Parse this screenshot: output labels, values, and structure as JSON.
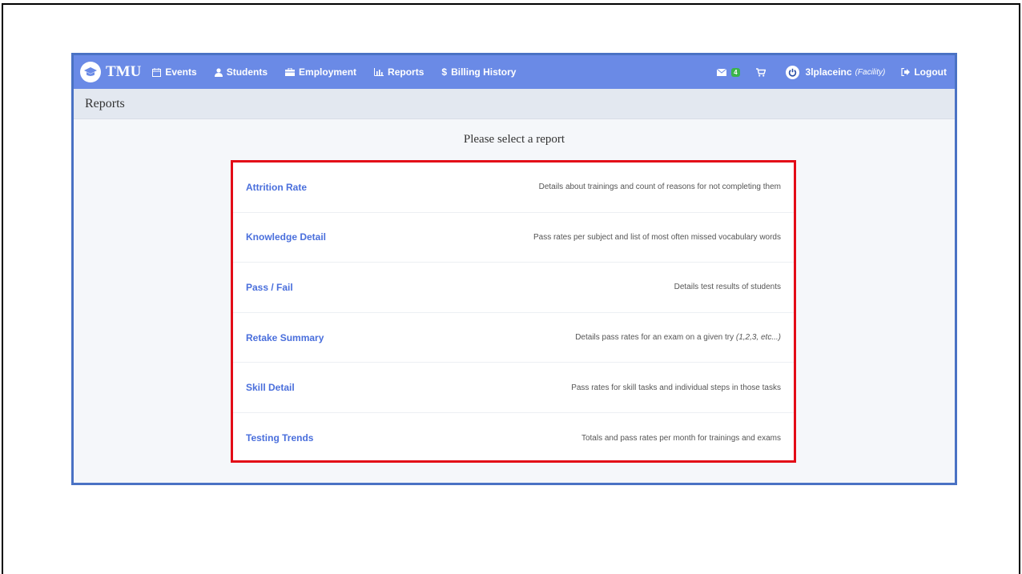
{
  "nav": {
    "brand": "TMU",
    "items": [
      {
        "label": "Events",
        "icon": "calendar-icon"
      },
      {
        "label": "Students",
        "icon": "user-icon"
      },
      {
        "label": "Employment",
        "icon": "building-icon"
      },
      {
        "label": "Reports",
        "icon": "bar-chart-icon"
      },
      {
        "label": "Billing History",
        "icon": "dollar-icon"
      }
    ],
    "mail_count": "4",
    "user_name": "3lplaceinc",
    "user_role": "(Facility)",
    "logout_label": "Logout"
  },
  "page": {
    "title": "Reports",
    "prompt": "Please select a report"
  },
  "reports": [
    {
      "name": "Attrition Rate",
      "description": "Details about trainings and count of reasons for not completing them",
      "description_extra": ""
    },
    {
      "name": "Knowledge Detail",
      "description": "Pass rates per subject and list of most often missed vocabulary words",
      "description_extra": ""
    },
    {
      "name": "Pass / Fail",
      "description": "Details test results of students",
      "description_extra": ""
    },
    {
      "name": "Retake Summary",
      "description": "Details pass rates for an exam on a given try ",
      "description_extra": "(1,2,3, etc...)"
    },
    {
      "name": "Skill Detail",
      "description": "Pass rates for skill tasks and individual steps in those tasks",
      "description_extra": ""
    },
    {
      "name": "Testing Trends",
      "description": "Totals and pass rates per month for trainings and exams",
      "description_extra": ""
    }
  ],
  "colors": {
    "navbar": "#6a8ae6",
    "highlight_border": "#e30b17",
    "link": "#4a6fdc",
    "badge": "#3bb54a"
  }
}
